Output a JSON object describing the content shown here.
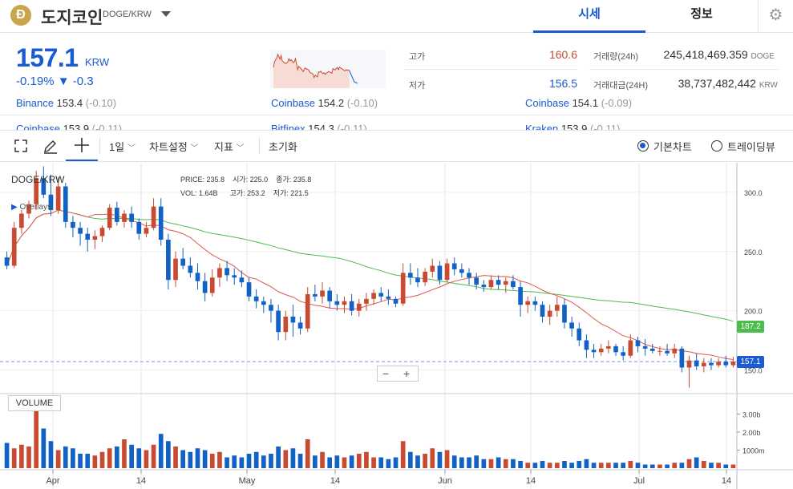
{
  "header": {
    "coin_icon_glyph": "Ð",
    "coin_name": "도지코인",
    "pair": "DOGE/KRW",
    "tabs": [
      {
        "label": "시세",
        "active": true
      },
      {
        "label": "정보",
        "active": false
      }
    ]
  },
  "summary": {
    "price": "157.1",
    "unit": "KRW",
    "change": "-0.19% ▼ -0.3",
    "high_label": "고가",
    "high_value": "160.6",
    "low_label": "저가",
    "low_value": "156.5",
    "volume_label": "거래량(24h)",
    "volume_value": "245,418,469.359",
    "volume_unit": "DOGE",
    "amount_label": "거래대금(24H)",
    "amount_value": "38,737,482,442",
    "amount_unit": "KRW"
  },
  "exchanges": [
    {
      "name": "Binance",
      "value": "153.4",
      "diff": "(-0.10)"
    },
    {
      "name": "Coinbase",
      "value": "154.2",
      "diff": "(-0.10)"
    },
    {
      "name": "Coinbase",
      "value": "154.1",
      "diff": "(-0.09)"
    },
    {
      "name": "Coinbase",
      "value": "153.9",
      "diff": "(-0.11)"
    },
    {
      "name": "Bitfinex",
      "value": "154.3",
      "diff": "(-0.11)"
    },
    {
      "name": "Kraken",
      "value": "153.9",
      "diff": "(-0.11)"
    }
  ],
  "toolbar": {
    "interval": "1일",
    "chart_settings": "차트설정",
    "indicators": "지표",
    "reset": "초기화",
    "basic_chart": "기본차트",
    "tradingview": "트레이딩뷰"
  },
  "chart_info": {
    "symbol": "DOGE/KRW",
    "overlays": "Overlays",
    "price_label": "PRICE:",
    "price": "235.8",
    "open_label": "시가:",
    "open": "225.0",
    "close_label": "종가:",
    "close": "235.8",
    "vol_label": "VOL:",
    "vol": "1.64B",
    "high_label": "고가:",
    "high": "253.2",
    "low_label": "저가:",
    "low": "221.5",
    "volume_title": "VOLUME",
    "current_price_tag": "157.1",
    "ma_tag": "187.2"
  },
  "colors": {
    "up": "#c84a31",
    "down": "#1261c4",
    "ma_short": "#e0584a",
    "ma_long": "#4cbc4c",
    "accent": "#1a5bd1"
  },
  "chart_data": {
    "type": "candlestick",
    "y_ticks": [
      "300.0",
      "250.0",
      "200.0",
      "150.0"
    ],
    "vol_ticks": [
      "3.00b",
      "2.00b",
      "1000m"
    ],
    "x_ticks": [
      "Apr",
      "14",
      "May",
      "14",
      "Jun",
      "14",
      "Jul",
      "14"
    ],
    "ylim": [
      130,
      325
    ],
    "candles": [
      [
        245,
        250,
        235,
        238
      ],
      [
        238,
        275,
        236,
        270
      ],
      [
        270,
        285,
        265,
        282
      ],
      [
        282,
        293,
        278,
        290
      ],
      [
        290,
        318,
        285,
        312
      ],
      [
        312,
        322,
        295,
        298
      ],
      [
        298,
        315,
        280,
        285
      ],
      [
        285,
        313,
        282,
        305
      ],
      [
        305,
        308,
        270,
        275
      ],
      [
        275,
        280,
        262,
        270
      ],
      [
        270,
        275,
        255,
        265
      ],
      [
        265,
        270,
        250,
        260
      ],
      [
        260,
        268,
        252,
        263
      ],
      [
        263,
        272,
        258,
        270
      ],
      [
        270,
        290,
        268,
        287
      ],
      [
        287,
        292,
        272,
        275
      ],
      [
        275,
        285,
        270,
        282
      ],
      [
        282,
        288,
        270,
        275
      ],
      [
        275,
        278,
        260,
        265
      ],
      [
        265,
        275,
        262,
        270
      ],
      [
        270,
        295,
        268,
        288
      ],
      [
        288,
        295,
        255,
        260
      ],
      [
        260,
        265,
        218,
        226
      ],
      [
        226,
        250,
        220,
        244
      ],
      [
        244,
        253,
        235,
        238
      ],
      [
        238,
        245,
        228,
        232
      ],
      [
        232,
        240,
        218,
        225
      ],
      [
        225,
        232,
        208,
        215
      ],
      [
        215,
        235,
        212,
        228
      ],
      [
        228,
        240,
        220,
        236
      ],
      [
        236,
        242,
        225,
        230
      ],
      [
        230,
        236,
        222,
        228
      ],
      [
        228,
        234,
        220,
        224
      ],
      [
        224,
        228,
        208,
        212
      ],
      [
        212,
        218,
        202,
        208
      ],
      [
        208,
        212,
        198,
        205
      ],
      [
        205,
        210,
        190,
        200
      ],
      [
        200,
        205,
        175,
        182
      ],
      [
        182,
        200,
        175,
        195
      ],
      [
        195,
        205,
        178,
        190
      ],
      [
        190,
        195,
        180,
        185
      ],
      [
        185,
        220,
        182,
        214
      ],
      [
        214,
        222,
        208,
        212
      ],
      [
        212,
        224,
        206,
        217
      ],
      [
        217,
        220,
        202,
        208
      ],
      [
        208,
        214,
        200,
        205
      ],
      [
        205,
        212,
        198,
        208
      ],
      [
        208,
        214,
        196,
        200
      ],
      [
        200,
        210,
        195,
        206
      ],
      [
        206,
        215,
        200,
        210
      ],
      [
        210,
        218,
        205,
        215
      ],
      [
        215,
        220,
        208,
        212
      ],
      [
        212,
        218,
        205,
        210
      ],
      [
        210,
        212,
        203,
        206
      ],
      [
        206,
        240,
        204,
        232
      ],
      [
        232,
        240,
        222,
        228
      ],
      [
        228,
        236,
        220,
        224
      ],
      [
        224,
        236,
        221,
        233
      ],
      [
        233,
        244,
        228,
        238
      ],
      [
        238,
        242,
        222,
        226
      ],
      [
        226,
        244,
        224,
        240
      ],
      [
        240,
        245,
        230,
        235
      ],
      [
        235,
        240,
        228,
        232
      ],
      [
        232,
        236,
        222,
        228
      ],
      [
        228,
        232,
        218,
        222
      ],
      [
        222,
        226,
        216,
        220
      ],
      [
        220,
        230,
        218,
        226
      ],
      [
        226,
        230,
        218,
        222
      ],
      [
        222,
        228,
        215,
        225
      ],
      [
        225,
        230,
        218,
        220
      ],
      [
        220,
        225,
        195,
        205
      ],
      [
        205,
        212,
        198,
        208
      ],
      [
        208,
        212,
        200,
        205
      ],
      [
        205,
        208,
        190,
        195
      ],
      [
        195,
        205,
        188,
        200
      ],
      [
        200,
        212,
        195,
        205
      ],
      [
        205,
        210,
        185,
        190
      ],
      [
        190,
        195,
        178,
        185
      ],
      [
        185,
        190,
        170,
        175
      ],
      [
        175,
        180,
        160,
        167
      ],
      [
        167,
        172,
        160,
        165
      ],
      [
        165,
        172,
        162,
        168
      ],
      [
        168,
        175,
        164,
        170
      ],
      [
        170,
        172,
        162,
        165
      ],
      [
        165,
        170,
        158,
        162
      ],
      [
        162,
        180,
        160,
        175
      ],
      [
        175,
        178,
        165,
        170
      ],
      [
        170,
        176,
        162,
        168
      ],
      [
        168,
        172,
        164,
        166
      ],
      [
        166,
        170,
        162,
        166
      ],
      [
        166,
        172,
        162,
        164
      ],
      [
        164,
        172,
        160,
        168
      ],
      [
        168,
        170,
        148,
        152
      ],
      [
        152,
        162,
        135,
        158
      ],
      [
        158,
        164,
        150,
        153
      ],
      [
        153,
        160,
        148,
        156
      ],
      [
        156,
        160,
        150,
        154
      ],
      [
        154,
        160,
        152,
        157
      ],
      [
        157,
        162,
        152,
        154
      ],
      [
        154,
        161,
        152,
        157
      ]
    ],
    "volumes": [
      1.4,
      1.1,
      1.3,
      1.2,
      3.4,
      2.2,
      1.5,
      1.0,
      1.2,
      1.1,
      0.8,
      0.8,
      0.7,
      0.9,
      1.1,
      1.2,
      1.6,
      1.3,
      1.1,
      1.0,
      1.3,
      1.9,
      1.5,
      1.2,
      1.0,
      0.9,
      1.1,
      1.0,
      0.8,
      0.9,
      0.6,
      0.7,
      0.6,
      0.8,
      0.9,
      0.7,
      0.8,
      1.2,
      1.0,
      1.1,
      0.8,
      1.6,
      0.7,
      0.9,
      0.6,
      0.7,
      0.6,
      0.7,
      0.8,
      0.9,
      0.6,
      0.6,
      0.5,
      0.6,
      1.5,
      0.9,
      0.7,
      0.8,
      1.1,
      0.9,
      1.0,
      0.7,
      0.6,
      0.6,
      0.7,
      0.5,
      0.5,
      0.6,
      0.5,
      0.5,
      0.4,
      0.3,
      0.3,
      0.4,
      0.3,
      0.3,
      0.4,
      0.3,
      0.4,
      0.5,
      0.3,
      0.3,
      0.3,
      0.3,
      0.3,
      0.4,
      0.3,
      0.2,
      0.2,
      0.2,
      0.2,
      0.3,
      0.3,
      0.5,
      0.6,
      0.4,
      0.3,
      0.3,
      0.2,
      0.2
    ]
  }
}
